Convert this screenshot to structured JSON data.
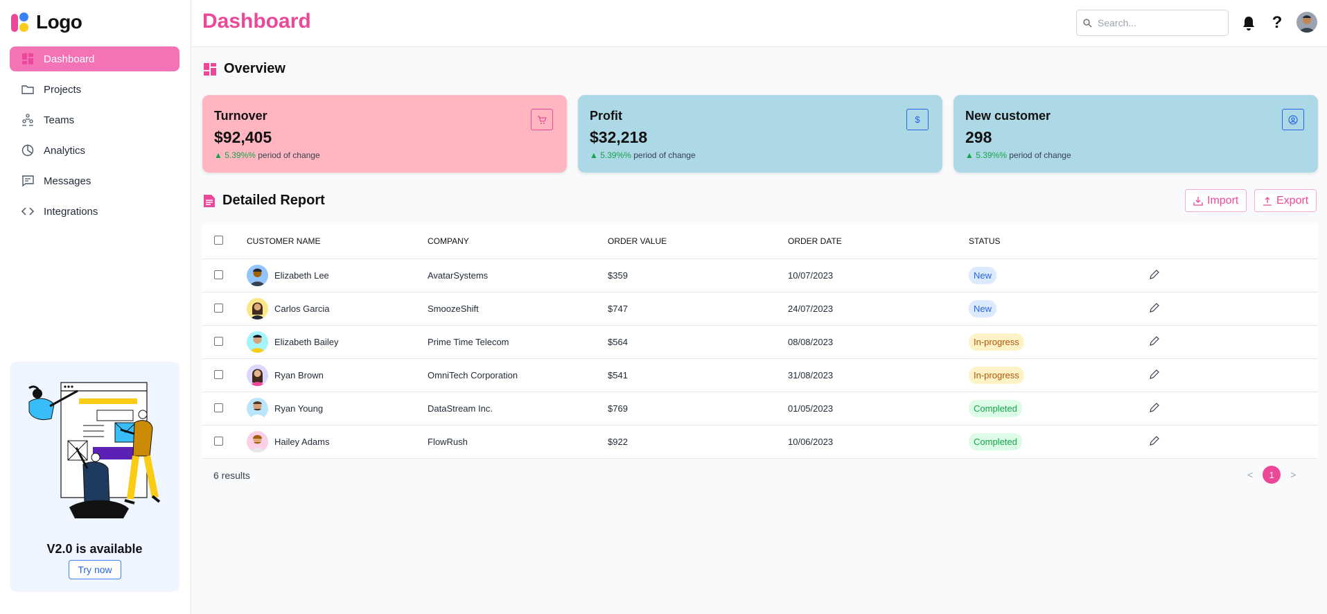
{
  "brand": {
    "logo_text": "Logo"
  },
  "sidebar": {
    "items": [
      {
        "label": "Dashboard",
        "icon": "dashboard-icon",
        "active": true
      },
      {
        "label": "Projects",
        "icon": "folder-icon",
        "active": false
      },
      {
        "label": "Teams",
        "icon": "teams-icon",
        "active": false
      },
      {
        "label": "Analytics",
        "icon": "pie-chart-icon",
        "active": false
      },
      {
        "label": "Messages",
        "icon": "message-icon",
        "active": false
      },
      {
        "label": "Integrations",
        "icon": "code-icon",
        "active": false
      }
    ],
    "promo": {
      "title": "V2.0 is available",
      "button": "Try now"
    }
  },
  "header": {
    "title": "Dashboard",
    "search_placeholder": "Search...",
    "help_glyph": "?"
  },
  "overview": {
    "title": "Overview",
    "cards": [
      {
        "title": "Turnover",
        "value": "$92,405",
        "change": "▲ 5.39%%",
        "change_text": "period of change",
        "icon": "cart-icon",
        "color": "#ffb6c1"
      },
      {
        "title": "Profit",
        "value": "$32,218",
        "change": "▲ 5.39%%",
        "change_text": "period of change",
        "icon": "dollar-icon",
        "color": "#add8e6"
      },
      {
        "title": "New customer",
        "value": "298",
        "change": "▲ 5.39%%",
        "change_text": "period of change",
        "icon": "user-circle-icon",
        "color": "#add8e6"
      }
    ]
  },
  "report": {
    "title": "Detailed Report",
    "import_label": "Import",
    "export_label": "Export",
    "columns": [
      "Customer Name",
      "Company",
      "Order Value",
      "Order Date",
      "Status"
    ],
    "rows": [
      {
        "name": "Elizabeth Lee",
        "company": "AvatarSystems",
        "value": "$359",
        "date": "10/07/2023",
        "status": "New"
      },
      {
        "name": "Carlos Garcia",
        "company": "SmoozeShift",
        "value": "$747",
        "date": "24/07/2023",
        "status": "New"
      },
      {
        "name": "Elizabeth Bailey",
        "company": "Prime Time Telecom",
        "value": "$564",
        "date": "08/08/2023",
        "status": "In-progress"
      },
      {
        "name": "Ryan Brown",
        "company": "OmniTech Corporation",
        "value": "$541",
        "date": "31/08/2023",
        "status": "In-progress"
      },
      {
        "name": "Ryan Young",
        "company": "DataStream Inc.",
        "value": "$769",
        "date": "01/05/2023",
        "status": "Completed"
      },
      {
        "name": "Hailey Adams",
        "company": "FlowRush",
        "value": "$922",
        "date": "10/06/2023",
        "status": "Completed"
      }
    ],
    "results_text": "6 results",
    "pagination": {
      "prev": "<",
      "current": "1",
      "next": ">"
    }
  },
  "colors": {
    "accent": "#ec4899",
    "accent_light": "#f472b6",
    "blue": "#2563eb",
    "positive": "#16a34a"
  }
}
